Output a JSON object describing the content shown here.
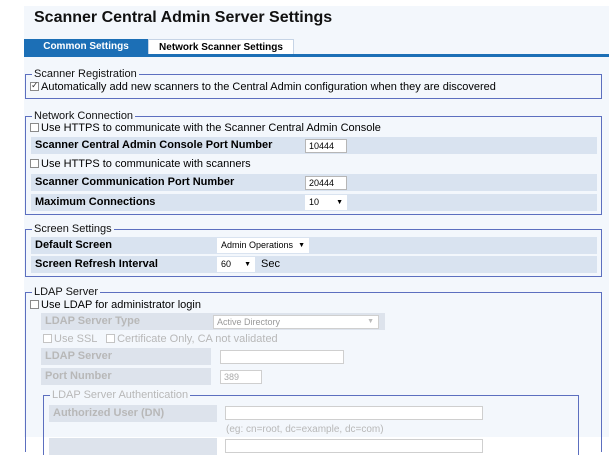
{
  "title": "Scanner Central Admin Server Settings",
  "tabs": [
    {
      "label": "Common Settings",
      "active": true
    },
    {
      "label": "Network Scanner Settings",
      "active": false
    }
  ],
  "scanner_registration": {
    "legend": "Scanner Registration",
    "auto_add_label": "Automatically add new scanners to the Central Admin configuration when they are discovered",
    "auto_add_checked": true
  },
  "network_connection": {
    "legend": "Network Connection",
    "https_console_label": "Use HTTPS to communicate with the Scanner Central Admin Console",
    "https_console_checked": false,
    "console_port_label": "Scanner Central Admin Console Port Number",
    "console_port_value": "10444",
    "https_scanners_label": "Use HTTPS to communicate with scanners",
    "https_scanners_checked": false,
    "scanner_port_label": "Scanner Communication Port Number",
    "scanner_port_value": "20444",
    "max_connections_label": "Maximum Connections",
    "max_connections_value": "10"
  },
  "screen_settings": {
    "legend": "Screen Settings",
    "default_screen_label": "Default Screen",
    "default_screen_value": "Admin Operations",
    "refresh_label": "Screen Refresh Interval",
    "refresh_value": "60",
    "refresh_unit": "Sec"
  },
  "ldap": {
    "legend": "LDAP Server",
    "use_ldap_label": "Use LDAP for administrator login",
    "use_ldap_checked": false,
    "server_type_label": "LDAP Server Type",
    "server_type_value": "Active Directory",
    "use_ssl_label": "Use SSL",
    "cert_only_label": "Certificate Only, CA not validated",
    "server_label": "LDAP Server",
    "port_label": "Port Number",
    "port_value": "389",
    "auth": {
      "legend": "LDAP Server Authentication",
      "user_label": "Authorized User (DN)",
      "user_hint": "(eg: cn=root, dc=example, dc=com)"
    }
  },
  "icons": {
    "dropdown": "chevron-down-icon",
    "check": "checkmark-icon"
  }
}
